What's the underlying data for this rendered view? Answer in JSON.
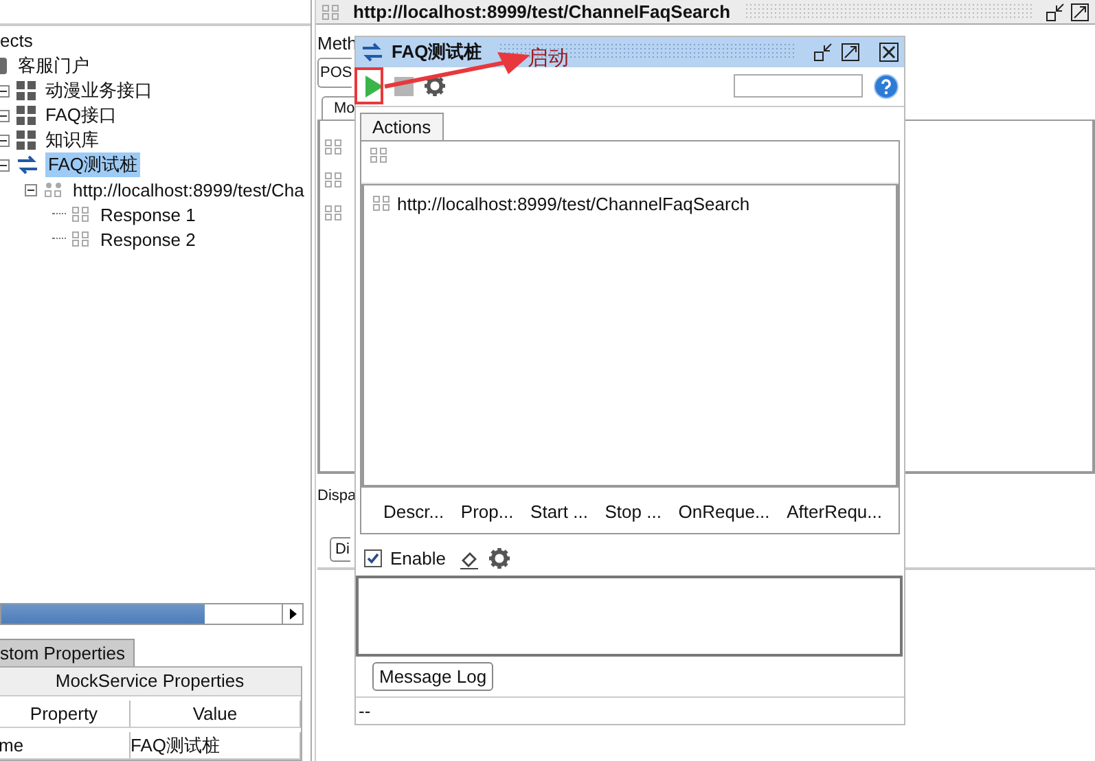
{
  "navigator": {
    "header": "ects",
    "tree": [
      {
        "label": "客服门户",
        "kind": "project",
        "selected": false,
        "children": [
          {
            "label": "动漫业务接口",
            "kind": "interface",
            "expanded": true,
            "selected": false
          },
          {
            "label": "FAQ接口",
            "kind": "interface",
            "expanded": true,
            "selected": false
          },
          {
            "label": "知识库",
            "kind": "interface",
            "expanded": true,
            "selected": false
          },
          {
            "label": "FAQ测试桩",
            "kind": "mock",
            "expanded": true,
            "selected": true,
            "children": [
              {
                "label": "http://localhost:8999/test/Cha",
                "kind": "request",
                "expanded": true,
                "selected": false,
                "children": [
                  {
                    "label": "Response 1",
                    "kind": "response",
                    "selected": false
                  },
                  {
                    "label": "Response 2",
                    "kind": "response",
                    "selected": false
                  }
                ]
              }
            ]
          }
        ]
      }
    ]
  },
  "properties": {
    "tab": "stom Properties",
    "title": "MockService Properties",
    "columns": [
      "Property",
      "Value"
    ],
    "rows": [
      [
        "me",
        "FAQ测试桩"
      ]
    ]
  },
  "editor": {
    "title": "http://localhost:8999/test/ChannelFaqSearch",
    "method_label": "Meth",
    "method_value": "POS",
    "tab": "Mo",
    "dispatch_label": "Dispa",
    "dispatch_button": "Di"
  },
  "mock_window": {
    "title": "FAQ测试桩",
    "tab": "Actions",
    "actions": [
      "http://localhost:8999/test/ChannelFaqSearch"
    ],
    "event_tabs": [
      "Descr...",
      "Prop...",
      "Start ...",
      "Stop ...",
      "OnReque...",
      "AfterRequ..."
    ],
    "enable": {
      "label": "Enable",
      "checked": true
    },
    "log_button": "Message Log",
    "status": "--"
  },
  "annotation": {
    "label": "启动"
  }
}
